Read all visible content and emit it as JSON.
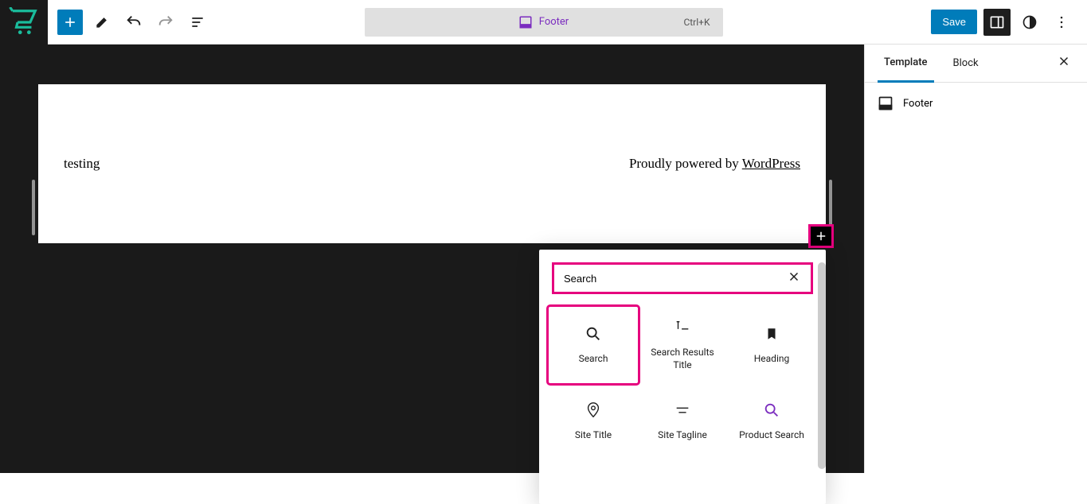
{
  "header": {
    "center_label": "Footer",
    "shortcut": "Ctrl+K",
    "save": "Save"
  },
  "canvas": {
    "footer_left": "testing",
    "footer_powered_prefix": "Proudly powered by ",
    "footer_powered_link": "WordPress"
  },
  "inserter": {
    "search_value": "Search",
    "blocks": [
      {
        "label": "Search"
      },
      {
        "label": "Search Results Title"
      },
      {
        "label": "Heading"
      },
      {
        "label": "Site Title"
      },
      {
        "label": "Site Tagline"
      },
      {
        "label": "Product Search"
      }
    ]
  },
  "sidebar": {
    "tabs": {
      "template": "Template",
      "block": "Block"
    },
    "title": "Footer"
  }
}
